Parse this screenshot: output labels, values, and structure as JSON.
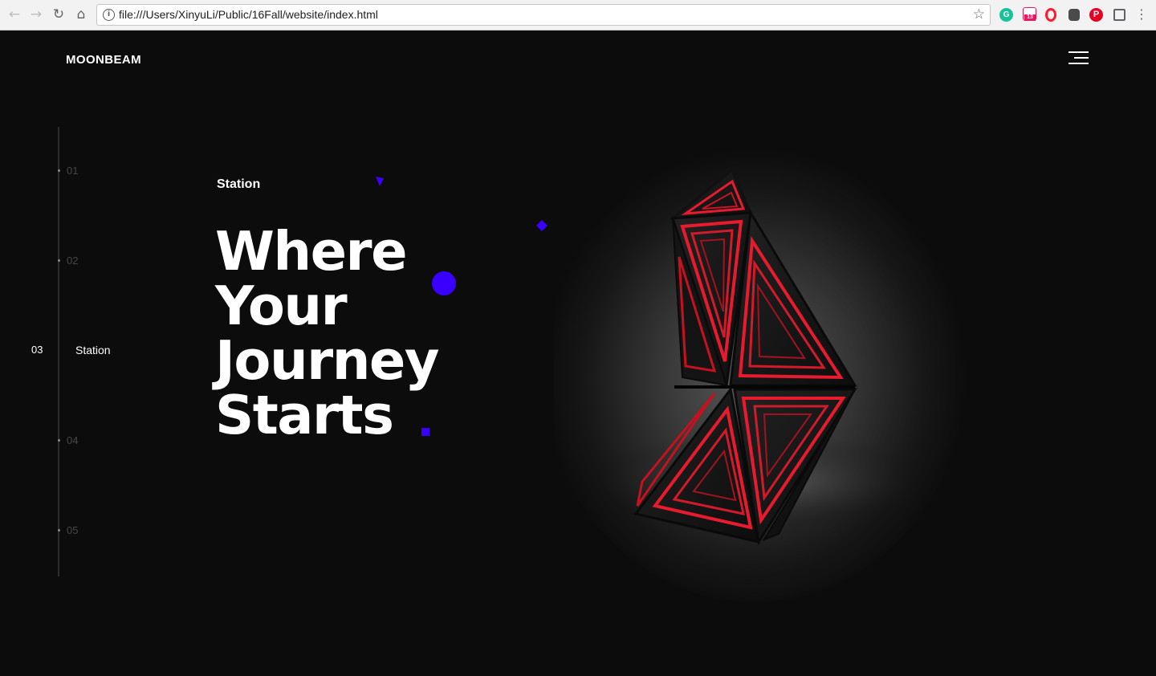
{
  "browser": {
    "url": "file:///Users/XinyuLi/Public/16Fall/website/index.html",
    "back_icon": "back-arrow-icon",
    "forward_icon": "forward-arrow-icon",
    "reload_icon": "reload-icon",
    "home_icon": "home-icon",
    "extensions": [
      {
        "name": "grammarly-extension-icon",
        "color": "#15c39a"
      },
      {
        "name": "calendar-extension-icon",
        "color": "#e8185c",
        "badge": "13"
      },
      {
        "name": "opera-extension-icon",
        "color": "#ff1b2d"
      },
      {
        "name": "evernote-extension-icon",
        "color": "#4a4a4a"
      },
      {
        "name": "pinterest-extension-icon",
        "color": "#e60023"
      },
      {
        "name": "square-extension-icon",
        "color": "#5f6368"
      }
    ]
  },
  "header": {
    "brand": "MOONBEAM",
    "menu_icon": "hamburger-menu-icon"
  },
  "rail": {
    "items": [
      {
        "number": "01"
      },
      {
        "number": "02"
      },
      {
        "number": "03",
        "label": "Station",
        "active": true
      },
      {
        "number": "04"
      },
      {
        "number": "05"
      }
    ]
  },
  "hero": {
    "eyebrow": "Station",
    "headline": [
      "Where",
      "Your",
      "Journey",
      "Starts"
    ]
  },
  "colors": {
    "background": "#0c0c0d",
    "accent": "#3a00ff",
    "artwork_red": "#e81b2e"
  }
}
